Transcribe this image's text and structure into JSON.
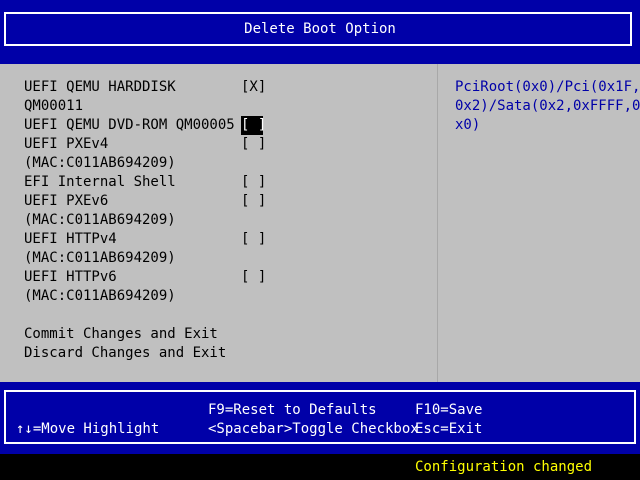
{
  "colors": {
    "title_background": "#0000a8",
    "main_background": "#c0c0c0",
    "help_text": "#0000a8",
    "status_text": "#ffff00",
    "selection_background": "#000000"
  },
  "header": {
    "title": "Delete Boot Option"
  },
  "boot_options": [
    {
      "label_lines": [
        "UEFI QEMU HARDDISK",
        "QM00011"
      ],
      "checkbox": "[X]",
      "checked": true,
      "selected": false
    },
    {
      "label_lines": [
        "UEFI QEMU DVD-ROM QM00005"
      ],
      "checkbox": "[ ]",
      "checked": false,
      "selected": true
    },
    {
      "label_lines": [
        "UEFI PXEv4",
        "(MAC:C011AB694209)"
      ],
      "checkbox": "[ ]",
      "checked": false,
      "selected": false
    },
    {
      "label_lines": [
        "EFI Internal Shell"
      ],
      "checkbox": "[ ]",
      "checked": false,
      "selected": false
    },
    {
      "label_lines": [
        "UEFI PXEv6",
        "(MAC:C011AB694209)"
      ],
      "checkbox": "[ ]",
      "checked": false,
      "selected": false
    },
    {
      "label_lines": [
        "UEFI HTTPv4",
        "(MAC:C011AB694209)"
      ],
      "checkbox": "[ ]",
      "checked": false,
      "selected": false
    },
    {
      "label_lines": [
        "UEFI HTTPv6",
        "(MAC:C011AB694209)"
      ],
      "checkbox": "[ ]",
      "checked": false,
      "selected": false
    }
  ],
  "actions": {
    "commit": "Commit Changes and Exit",
    "discard": "Discard Changes and Exit"
  },
  "help": {
    "lines": [
      "PciRoot(0x0)/Pci(0x1F,",
      "0x2)/Sata(0x2,0xFFFF,0",
      "x0)"
    ]
  },
  "footer": {
    "move_highlight": "↑↓=Move Highlight",
    "reset_defaults": "F9=Reset to Defaults",
    "toggle_checkbox": "<Spacebar>Toggle Checkbox",
    "save": "F10=Save",
    "exit": "Esc=Exit"
  },
  "status": {
    "message": "Configuration changed"
  }
}
